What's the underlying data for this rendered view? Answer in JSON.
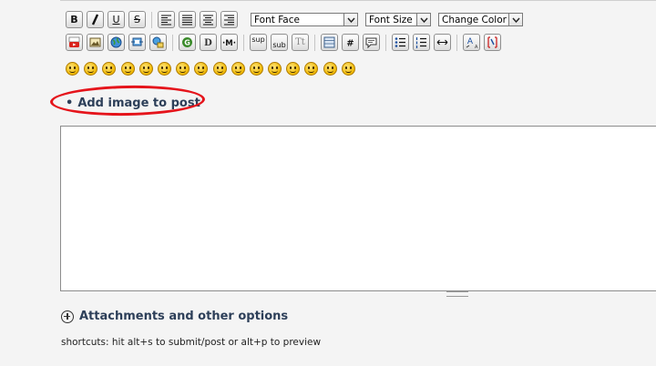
{
  "editor": {
    "font_face": "Font Face",
    "font_size": "Font Size",
    "change_color": "Change Color",
    "sup_label": "sup",
    "sub_label": "sub",
    "tt_label": "Tt",
    "format_buttons": [
      "B",
      "I",
      "U",
      "S"
    ],
    "accent_color": "#e5141b"
  },
  "post": {
    "add_image_label": "Add image to post",
    "attachments_label": "Attachments and other options",
    "shortcuts_text": "shortcuts: hit alt+s to submit/post or alt+p to preview"
  },
  "smileys": [
    "smile",
    "happy",
    "grin",
    "laugh",
    "angry",
    "sad",
    "nerd",
    "cool",
    "wink",
    "dizzy",
    "tongue",
    "frown",
    "blush",
    "confused",
    "tongue-out",
    "cry"
  ]
}
